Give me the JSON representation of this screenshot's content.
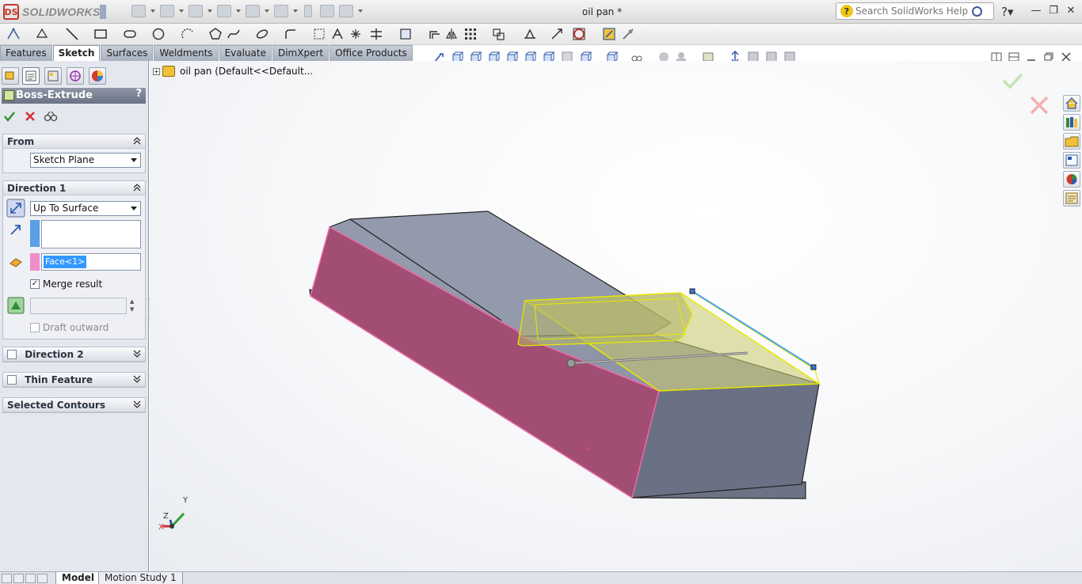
{
  "app": {
    "brand": "SOLIDWORKS",
    "document_title": "oil pan *",
    "help_search_placeholder": "Search SolidWorks Help"
  },
  "command_tabs": [
    {
      "label": "Features",
      "active": false
    },
    {
      "label": "Sketch",
      "active": true
    },
    {
      "label": "Surfaces",
      "active": false
    },
    {
      "label": "Weldments",
      "active": false
    },
    {
      "label": "Evaluate",
      "active": false
    },
    {
      "label": "DimXpert",
      "active": false
    },
    {
      "label": "Office Products",
      "active": false
    }
  ],
  "property_manager": {
    "title": "Boss-Extrude",
    "help": "?",
    "from": {
      "header": "From",
      "start_condition": "Sketch Plane"
    },
    "direction1": {
      "header": "Direction 1",
      "end_condition": "Up To Surface",
      "face_selection": "Face<1>",
      "merge_result_label": "Merge result",
      "merge_result_checked": true,
      "draft_outward_label": "Draft outward",
      "draft_outward_checked": false
    },
    "direction2": {
      "header": "Direction 2",
      "checked": false
    },
    "thin_feature": {
      "header": "Thin Feature",
      "checked": false
    },
    "selected_contours": {
      "header": "Selected Contours"
    }
  },
  "feature_tree": {
    "root_label": "oil pan  (Default<<Default..."
  },
  "bottom_tabs": [
    {
      "label": "Model",
      "active": true
    },
    {
      "label": "Motion Study 1",
      "active": false
    }
  ],
  "triad": {
    "x": "X",
    "y": "Y",
    "z": "Z"
  },
  "colors": {
    "face_selection": "#f08cc8",
    "direction_swatch": "#5aa0e6",
    "model_body": "#8a91a4",
    "selected_face": "#a24d74",
    "preview": "#e8e800"
  }
}
